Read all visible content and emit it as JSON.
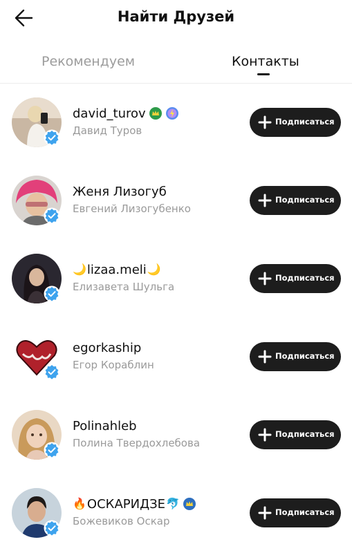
{
  "header": {
    "title": "Найти Друзей",
    "back_icon": "arrow-left-icon"
  },
  "tabs": [
    {
      "label": "Рекомендуем",
      "active": false
    },
    {
      "label": "Контакты",
      "active": true
    }
  ],
  "follow_label": "Подписаться",
  "users": [
    {
      "username": "david_turov",
      "full_name": "Давид Туров"
    },
    {
      "username": "Женя Лизогуб",
      "full_name": "Евгений Лизогубенко"
    },
    {
      "username": "lizaa.meli",
      "prefix": "🌙",
      "suffix": "🌙",
      "full_name": "Елизавета Шульга"
    },
    {
      "username": "egorkaship",
      "full_name": "Егор Кораблин"
    },
    {
      "username": "Polinahleb",
      "full_name": "Полина Твердохлебова"
    },
    {
      "username": "ОСКАРИДЗЕ",
      "prefix": "🔥",
      "suffix": "🐬",
      "full_name": "Божевиков Оскар"
    }
  ],
  "colors": {
    "button_bg": "#1d1d1d",
    "verified": "#3ea3ee",
    "secondary_text": "#9a9a9a"
  }
}
